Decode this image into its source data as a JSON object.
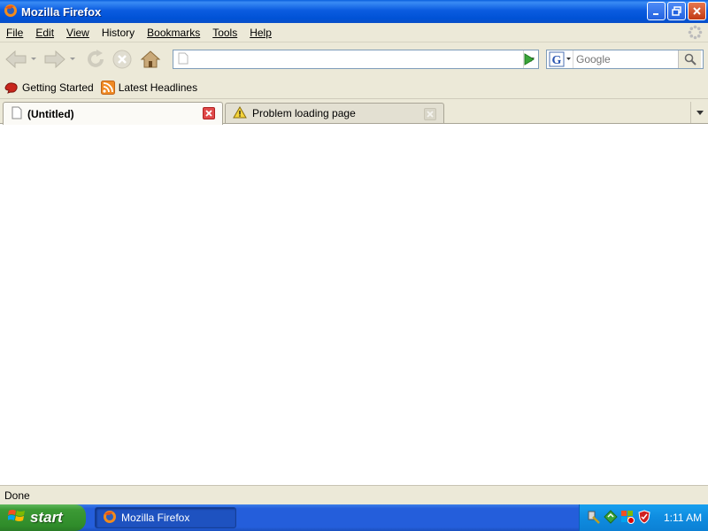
{
  "window": {
    "title": "Mozilla Firefox",
    "icon": "firefox-icon",
    "controls": [
      "minimize",
      "restore",
      "close"
    ]
  },
  "menu": {
    "items": [
      {
        "label": "File",
        "access": "F"
      },
      {
        "label": "Edit",
        "access": "E"
      },
      {
        "label": "View",
        "access": "V"
      },
      {
        "label": "History",
        "access": "s"
      },
      {
        "label": "Bookmarks",
        "access": "B"
      },
      {
        "label": "Tools",
        "access": "T"
      },
      {
        "label": "Help",
        "access": "H"
      }
    ]
  },
  "navbar": {
    "url_value": "",
    "search_placeholder": "Google",
    "search_engine": "google-icon"
  },
  "bookmarks": {
    "items": [
      {
        "label": "Getting Started",
        "icon": "firefox-bookmark-icon"
      },
      {
        "label": "Latest Headlines",
        "icon": "rss-feed-icon"
      }
    ]
  },
  "tabs": [
    {
      "label": "(Untitled)",
      "active": true,
      "icon": "blank-page-icon"
    },
    {
      "label": "Problem loading page",
      "active": false,
      "icon": "warning-icon"
    }
  ],
  "status": {
    "text": "Done"
  },
  "taskbar": {
    "start_label": "start",
    "task_label": "Mozilla Firefox",
    "clock": "1:11 AM"
  },
  "colors": {
    "titlebar": "#0b5ce0",
    "chrome": "#ece9d8",
    "taskbar": "#245edb",
    "start": "#3c9a35",
    "tray": "#0f8ce0"
  }
}
